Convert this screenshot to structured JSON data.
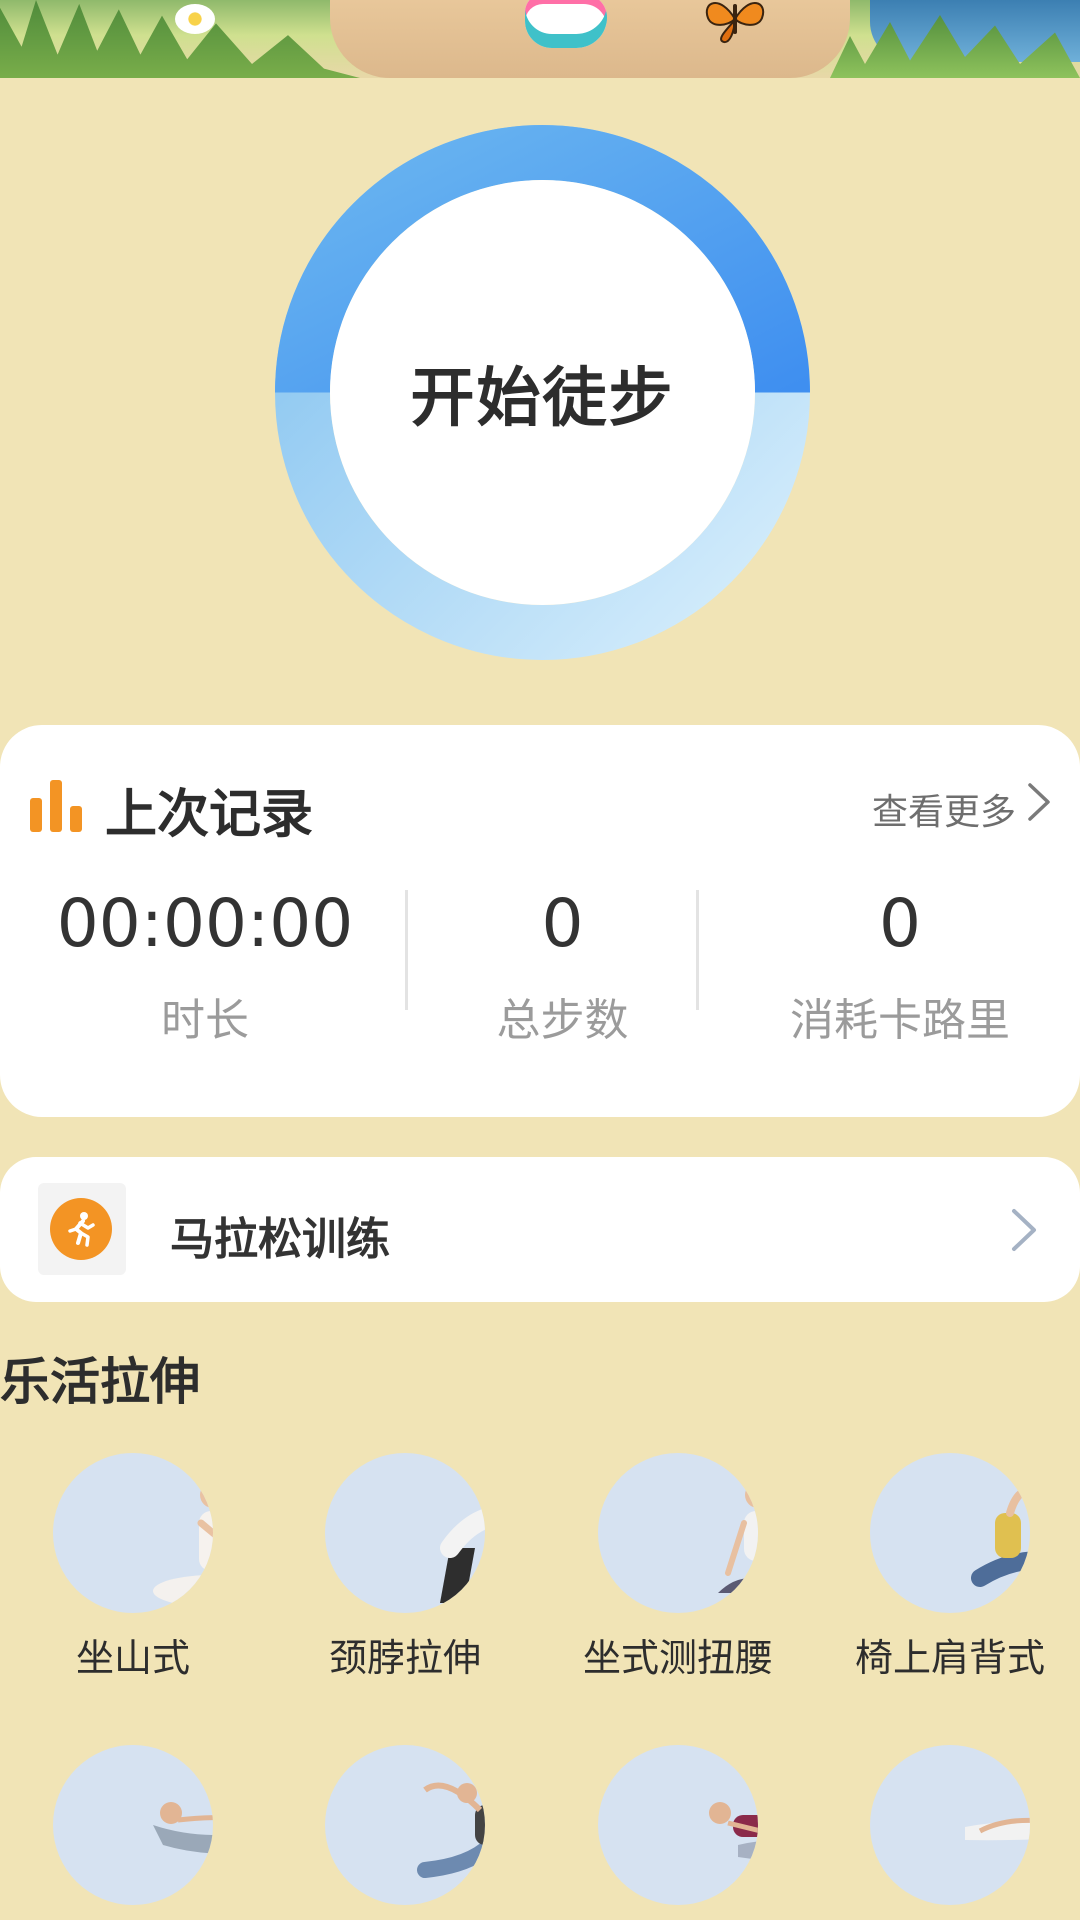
{
  "hero": {
    "start_label": "开始徒步"
  },
  "last_record": {
    "title": "上次记录",
    "more_label": "查看更多",
    "stats": [
      {
        "value": "00:00:00",
        "label": "时长"
      },
      {
        "value": "0",
        "label": "总步数"
      },
      {
        "value": "0",
        "label": "消耗卡路里"
      }
    ]
  },
  "marathon": {
    "label": "马拉松训练"
  },
  "stretch": {
    "title": "乐活拉伸",
    "items": [
      {
        "name": "坐山式"
      },
      {
        "name": "颈脖拉伸"
      },
      {
        "name": "坐式测扭腰"
      },
      {
        "name": "椅上肩背式"
      },
      {
        "name": ""
      },
      {
        "name": ""
      },
      {
        "name": ""
      },
      {
        "name": ""
      }
    ]
  },
  "colors": {
    "background": "#f1e4b6",
    "ring_progress": "#4e9ef1",
    "ring_track": "#d6ecfb",
    "accent_orange": "#f39424"
  }
}
